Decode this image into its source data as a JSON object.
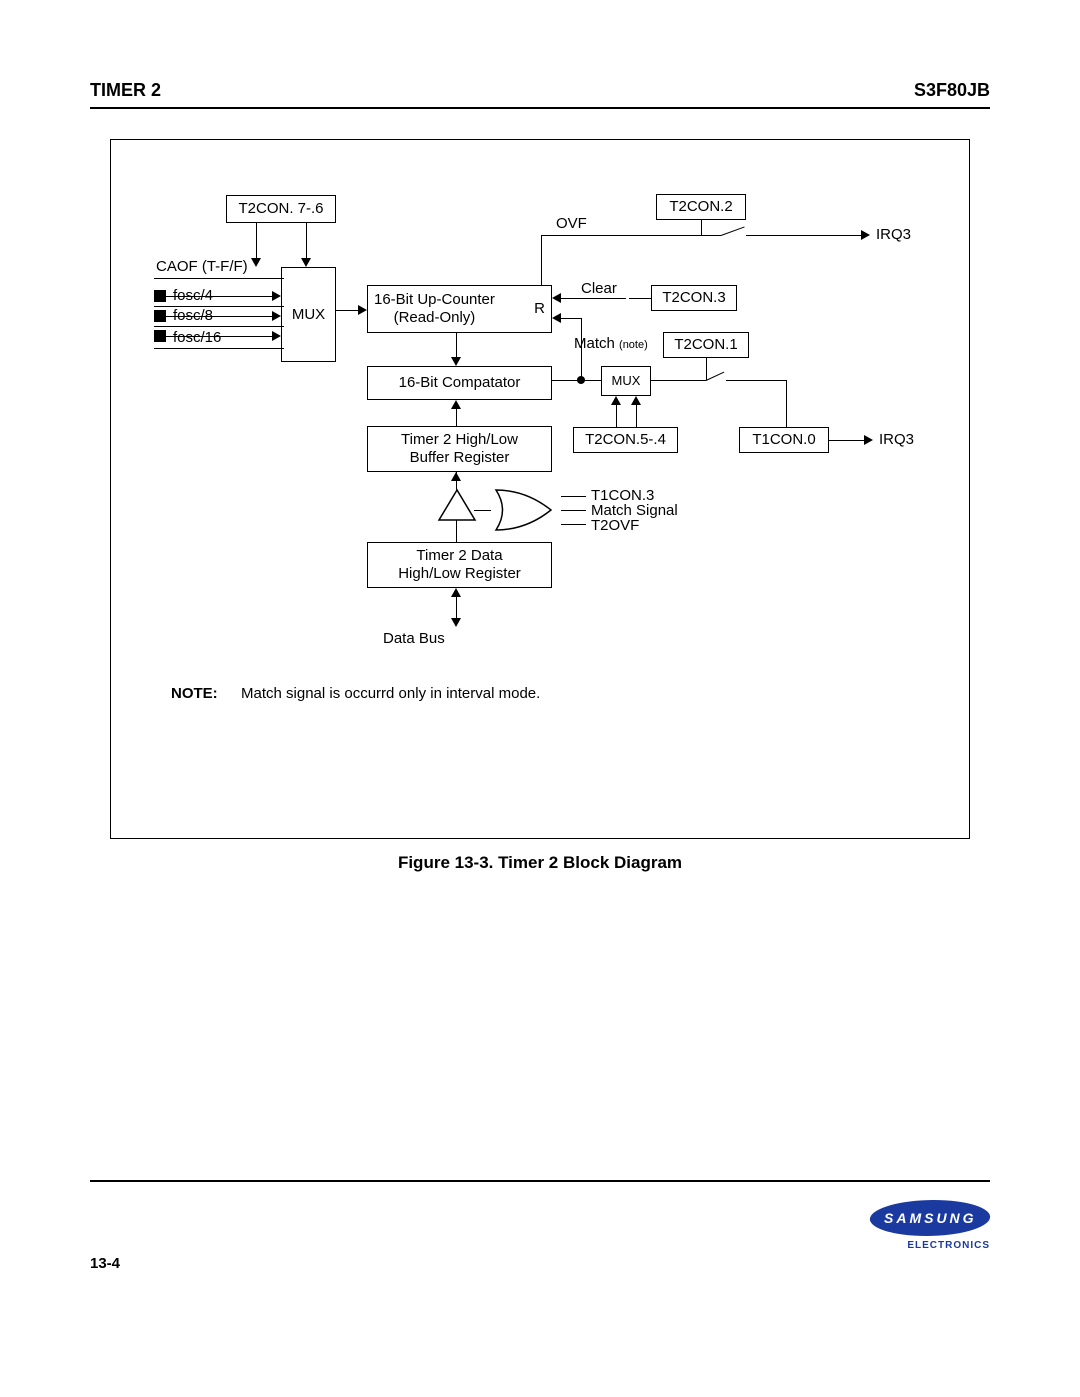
{
  "header": {
    "left": "TIMER 2",
    "right": "S3F80JB"
  },
  "footer": {
    "page": "13-4",
    "brand": "SAMSUNG",
    "sub": "ELECTRONICS"
  },
  "caption": "Figure 13-3. Timer 2 Block Diagram",
  "note": {
    "label": "NOTE:",
    "text": "Match signal is occurrd only in interval mode."
  },
  "diagram": {
    "t2con76": "T2CON. 7-.6",
    "caof": "CAOF (T-F/F)",
    "fosc4": "fosc/4",
    "fosc8": "fosc/8",
    "fosc16": "fosc/16",
    "mux_big": "MUX",
    "upcounter_l1": "16-Bit Up-Counter",
    "upcounter_l2": "(Read-Only)",
    "upcounter_r": "R",
    "ovf": "OVF",
    "clear": "Clear",
    "t2con2": "T2CON.2",
    "irq3_top": "IRQ3",
    "t2con3": "T2CON.3",
    "match": "Match",
    "match_note": "(note)",
    "t2con1": "T2CON.1",
    "mux_small": "MUX",
    "comparator": "16-Bit Compatator",
    "buffer_l1": "Timer 2 High/Low",
    "buffer_l2": "Buffer Register",
    "t2con54": "T2CON.5-.4",
    "t1con0": "T1CON.0",
    "irq3_bot": "IRQ3",
    "t1con3": "T1CON.3",
    "match_sig": "Match Signal",
    "t2ovf": "T2OVF",
    "datareg_l1": "Timer 2 Data",
    "datareg_l2": "High/Low Register",
    "databus": "Data Bus"
  }
}
